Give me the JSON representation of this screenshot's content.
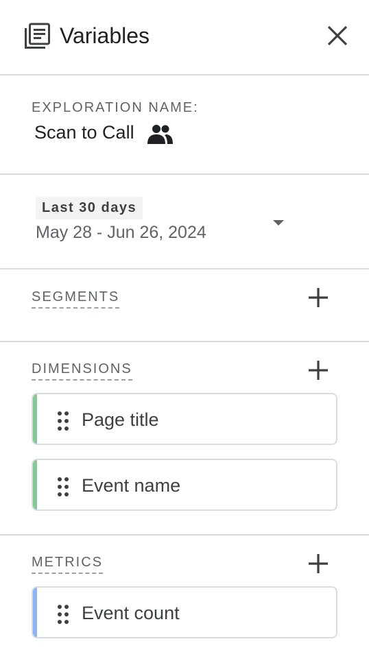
{
  "header": {
    "title": "Variables",
    "icon": "list-panel-icon",
    "close_icon": "close-icon"
  },
  "exploration": {
    "label": "EXPLORATION NAME:",
    "name": "Scan to Call",
    "shared_icon": "people-icon"
  },
  "date": {
    "preset": "Last 30 days",
    "range": "May 28 - Jun 26, 2024"
  },
  "segments": {
    "label": "SEGMENTS"
  },
  "dimensions": {
    "label": "DIMENSIONS",
    "items": [
      "Page title",
      "Event name"
    ],
    "color": "#81c995"
  },
  "metrics": {
    "label": "METRICS",
    "items": [
      "Event count"
    ],
    "color": "#8ab4f8"
  }
}
